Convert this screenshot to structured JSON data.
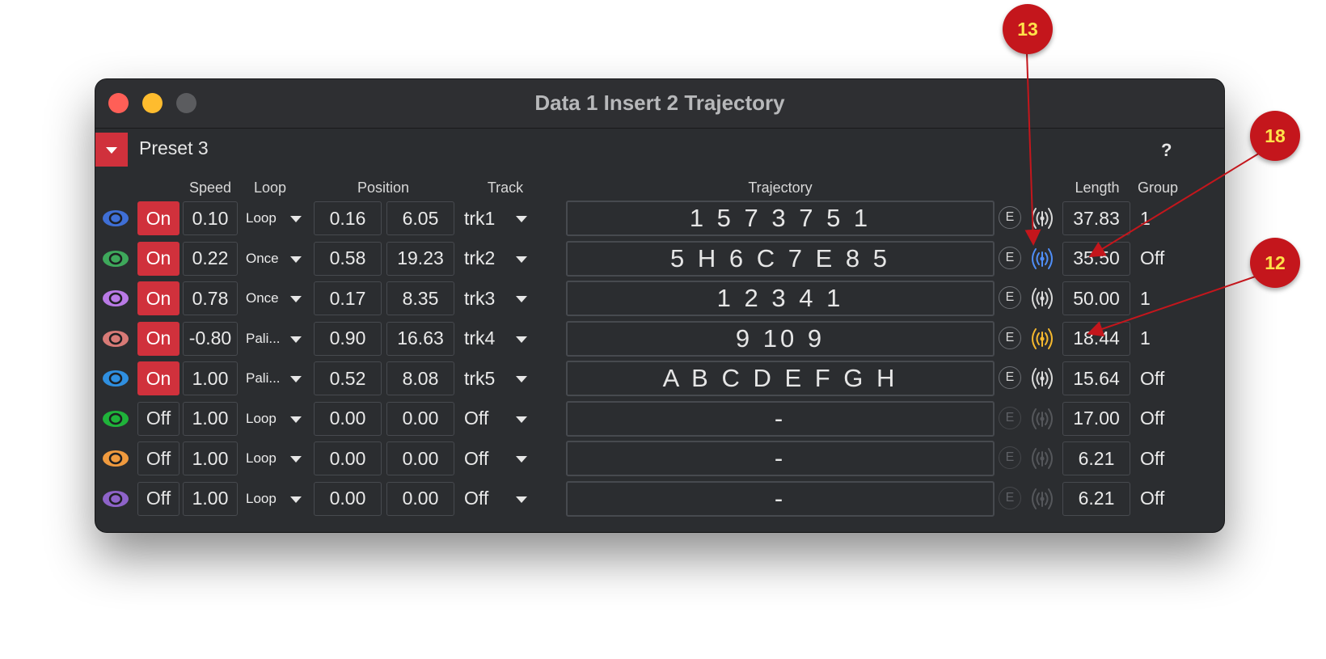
{
  "window": {
    "title": "Data 1 Insert 2 Trajectory"
  },
  "preset": {
    "label": "Preset 3",
    "help": "?"
  },
  "headers": {
    "speed": "Speed",
    "loop": "Loop",
    "position": "Position",
    "track": "Track",
    "trajectory": "Trajectory",
    "length": "Length",
    "group": "Group"
  },
  "rows": [
    {
      "eye_color": "#3f6fd6",
      "state": "On",
      "speed": "0.10",
      "loop": "Loop",
      "pos1": "0.16",
      "pos2": "6.05",
      "track": "trk1",
      "trajectory": "1 5 7 3 7 5 1",
      "edit": "E",
      "broadcast_color": "#d9d9d9",
      "length": "37.83",
      "group": "1",
      "active": true
    },
    {
      "eye_color": "#3ea85b",
      "state": "On",
      "speed": "0.22",
      "loop": "Once",
      "pos1": "0.58",
      "pos2": "19.23",
      "track": "trk2",
      "trajectory": "5 H 6 C 7 E 8 5",
      "edit": "E",
      "broadcast_color": "#4f8ef7",
      "length": "35.50",
      "group": "Off",
      "active": true
    },
    {
      "eye_color": "#b97ae6",
      "state": "On",
      "speed": "0.78",
      "loop": "Once",
      "pos1": "0.17",
      "pos2": "8.35",
      "track": "trk3",
      "trajectory": "1 2 3 4 1",
      "edit": "E",
      "broadcast_color": "#d9d9d9",
      "length": "50.00",
      "group": "1",
      "active": true
    },
    {
      "eye_color": "#d87a76",
      "state": "On",
      "speed": "-0.80",
      "loop": "Pali...",
      "pos1": "0.90",
      "pos2": "16.63",
      "track": "trk4",
      "trajectory": "9 10 9",
      "edit": "E",
      "broadcast_color": "#f5b82e",
      "length": "18.44",
      "group": "1",
      "active": true
    },
    {
      "eye_color": "#2f8fe0",
      "state": "On",
      "speed": "1.00",
      "loop": "Pali...",
      "pos1": "0.52",
      "pos2": "8.08",
      "track": "trk5",
      "trajectory": "A B C D E F G H",
      "edit": "E",
      "broadcast_color": "#d9d9d9",
      "length": "15.64",
      "group": "Off",
      "active": true
    },
    {
      "eye_color": "#1fb33a",
      "state": "Off",
      "speed": "1.00",
      "loop": "Loop",
      "pos1": "0.00",
      "pos2": "0.00",
      "track": "Off",
      "trajectory": "-",
      "edit": "E",
      "broadcast_color": "#55575b",
      "length": "17.00",
      "group": "Off",
      "active": false
    },
    {
      "eye_color": "#f09a3e",
      "state": "Off",
      "speed": "1.00",
      "loop": "Loop",
      "pos1": "0.00",
      "pos2": "0.00",
      "track": "Off",
      "trajectory": "-",
      "edit": "E",
      "broadcast_color": "#55575b",
      "length": "6.21",
      "group": "Off",
      "active": false
    },
    {
      "eye_color": "#8e63c9",
      "state": "Off",
      "speed": "1.00",
      "loop": "Loop",
      "pos1": "0.00",
      "pos2": "0.00",
      "track": "Off",
      "trajectory": "-",
      "edit": "E",
      "broadcast_color": "#55575b",
      "length": "6.21",
      "group": "Off",
      "active": false
    }
  ],
  "callouts": [
    "13",
    "18",
    "12"
  ]
}
